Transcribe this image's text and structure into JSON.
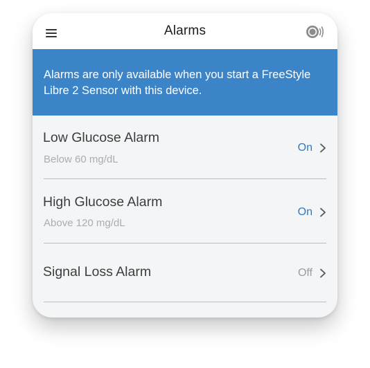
{
  "header": {
    "title": "Alarms",
    "menu_icon": "hamburger-menu-icon",
    "sensor_icon": "sensor-scan-icon"
  },
  "banner": {
    "text": "Alarms are only available when you start a FreeStyle Libre 2 Sensor with this device.",
    "color": "#3c84c8"
  },
  "alarms": [
    {
      "title": "Low Glucose Alarm",
      "subtitle": "Below 60 mg/dL",
      "status": "On",
      "status_color": "#2f7bbf"
    },
    {
      "title": "High Glucose Alarm",
      "subtitle": "Above 120 mg/dL",
      "status": "On",
      "status_color": "#2f7bbf"
    },
    {
      "title": "Signal Loss Alarm",
      "subtitle": "",
      "status": "Off",
      "status_color": "#9a9ea2"
    }
  ]
}
